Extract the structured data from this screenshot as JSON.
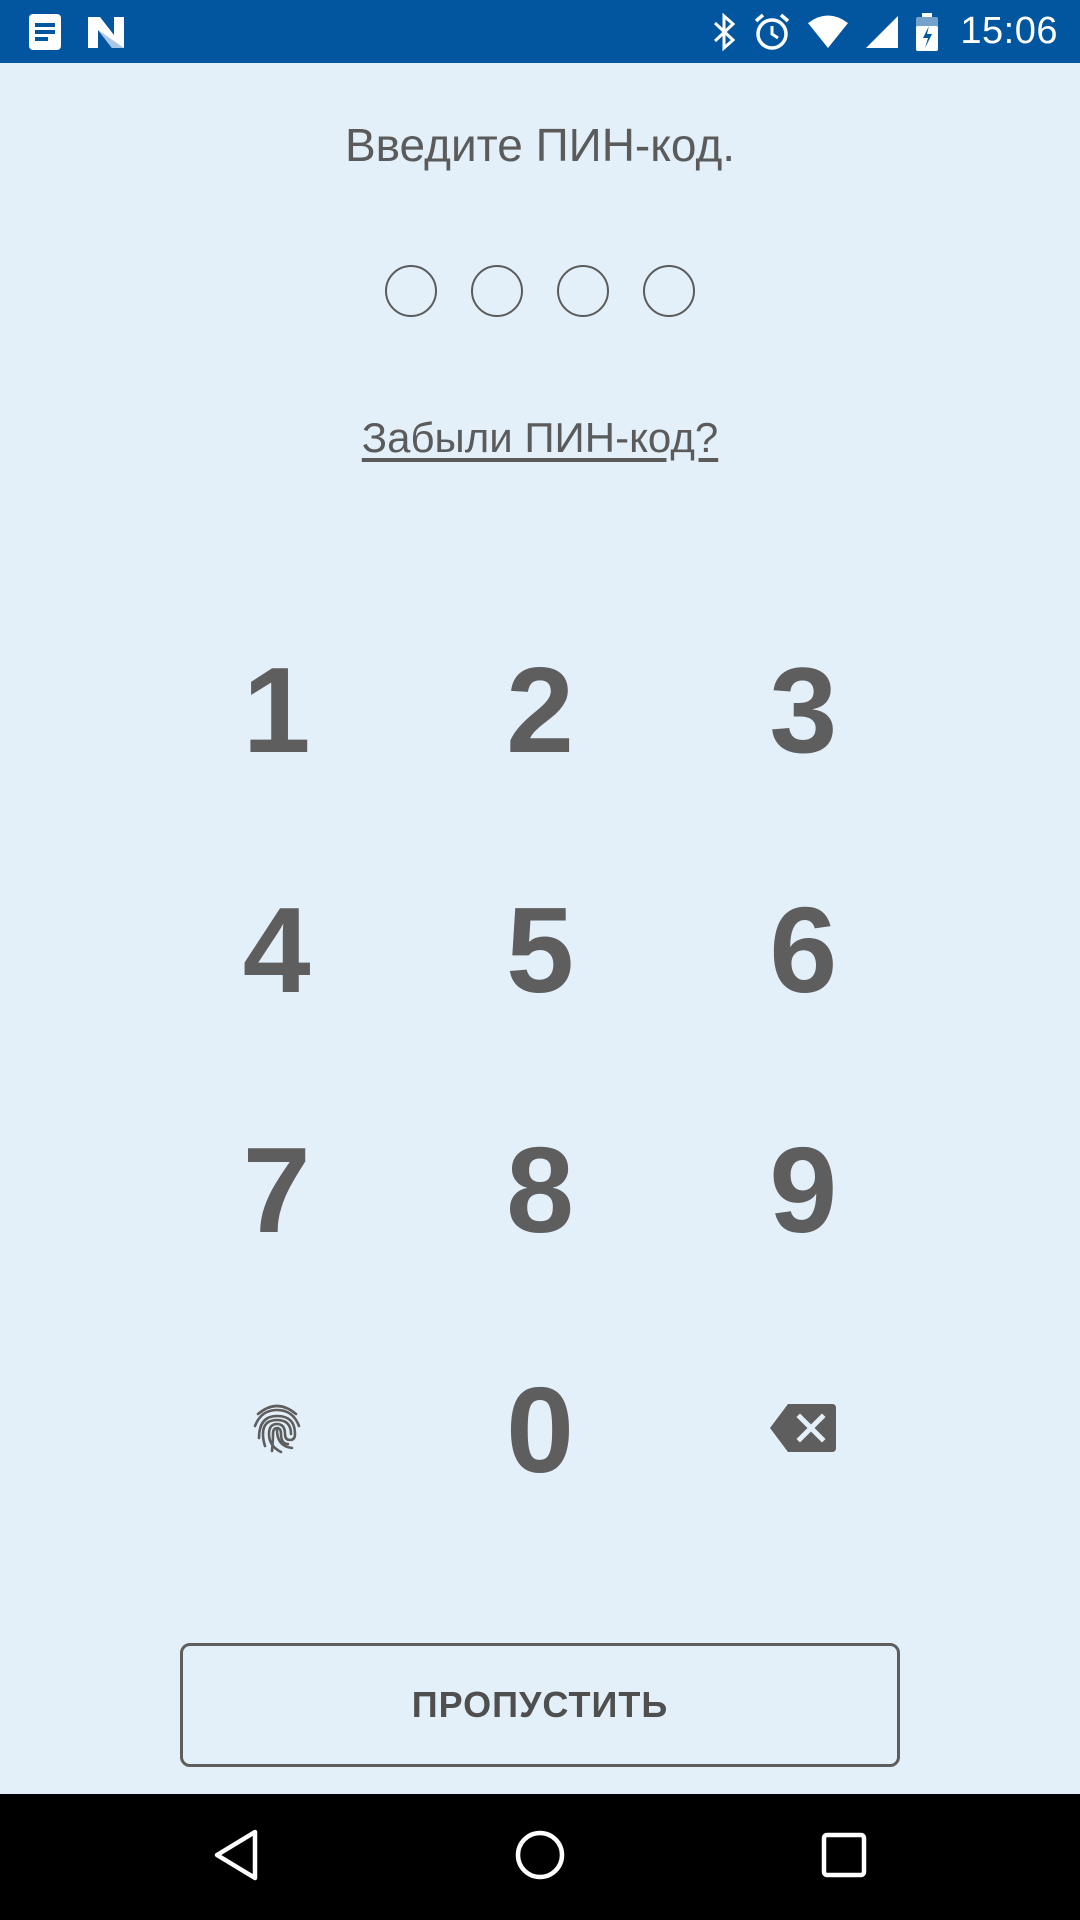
{
  "status_bar": {
    "time": "15:06",
    "left_icons": [
      "notes-icon",
      "app-n-icon"
    ],
    "right_icons": [
      "bluetooth-icon",
      "alarm-icon",
      "wifi-icon",
      "signal-icon",
      "battery-icon"
    ]
  },
  "pin": {
    "title": "Введите ПИН-код.",
    "digits_total": 4,
    "digits_entered": 0,
    "forgot_label": "Забыли ПИН-код?"
  },
  "keypad": {
    "keys": [
      "1",
      "2",
      "3",
      "4",
      "5",
      "6",
      "7",
      "8",
      "9",
      "0"
    ],
    "fingerprint_icon": "fingerprint-icon",
    "backspace_icon": "backspace-icon"
  },
  "skip_label": "ПРОПУСТИТЬ",
  "nav_bar": {
    "icons": [
      "back-icon",
      "home-icon",
      "recents-icon"
    ]
  },
  "colors": {
    "status_bar": "#02569f",
    "background": "#e3f0f9",
    "text": "#5b5b5b",
    "nav_bar": "#000000"
  }
}
